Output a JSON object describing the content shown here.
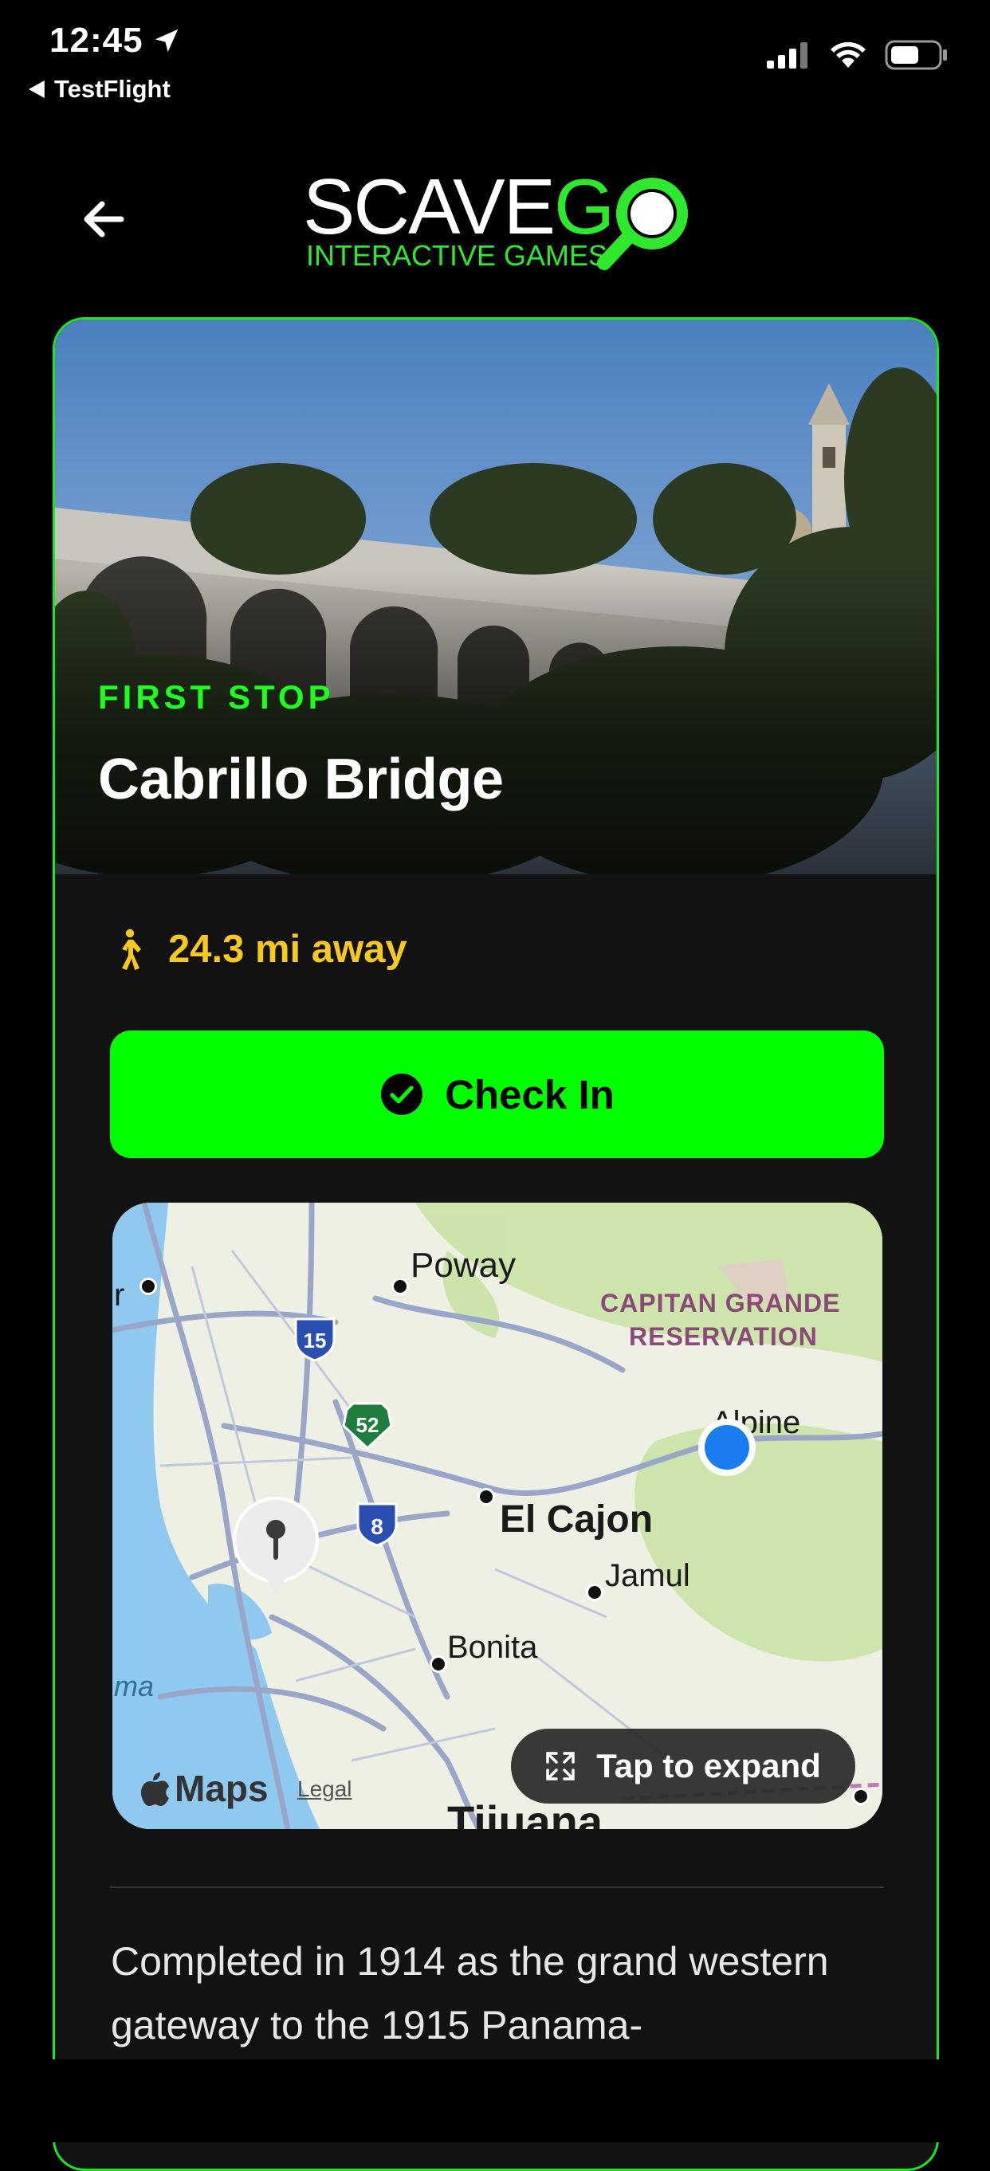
{
  "status": {
    "time": "12:45",
    "back_app": "TestFlight"
  },
  "logo": {
    "word_main": "SCAVE",
    "word_accent": "G",
    "tagline": "INTERACTIVE GAMES"
  },
  "stop": {
    "eyebrow": "FIRST STOP",
    "title": "Cabrillo Bridge",
    "distance": "24.3 mi away"
  },
  "actions": {
    "check_in": "Check In",
    "expand": "Tap to expand"
  },
  "map": {
    "labels": {
      "poway": "Poway",
      "reservation_line1": "CAPITAN GRANDE",
      "reservation_line2": "RESERVATION",
      "alpine": "Alpine",
      "el_cajon": "El Cajon",
      "jamul": "Jamul",
      "bonita": "Bonita",
      "tijuana": "Tijuana",
      "left_edge": "ma",
      "left_edge_top": "r"
    },
    "shields": {
      "i15": "15",
      "sr52": "52",
      "i8": "8"
    },
    "attribution": "Maps",
    "legal": "Legal"
  },
  "description": "Completed in 1914 as the grand western gateway to the 1915 Panama-",
  "colors": {
    "accent_green": "#00ff00",
    "distance_yellow": "#f7c81d",
    "card_border": "#1be81b"
  },
  "icons": [
    "location-arrow-icon",
    "back-arrow-icon",
    "signal-icon",
    "wifi-icon",
    "battery-icon",
    "walking-icon",
    "checkmark-circle-icon",
    "expand-icon",
    "pin-icon",
    "apple-logo-icon"
  ]
}
